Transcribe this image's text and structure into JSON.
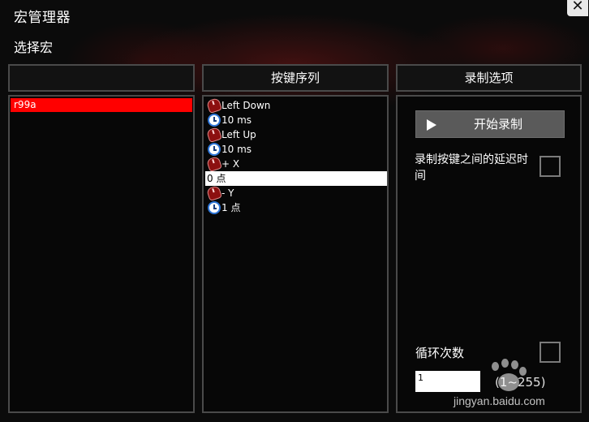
{
  "window": {
    "title": "宏管理器",
    "close_label": "✕"
  },
  "section_label": "选择宏",
  "macro_panel": {
    "header": "",
    "items": [
      {
        "label": "r99a",
        "selected": true
      }
    ]
  },
  "key_sequence": {
    "header": "按键序列",
    "items": [
      {
        "icon": "mouse-icon",
        "label": "Left Down"
      },
      {
        "icon": "clock-icon",
        "label": "10 ms"
      },
      {
        "icon": "mouse-icon",
        "label": "Left Up"
      },
      {
        "icon": "clock-icon",
        "label": "10 ms"
      },
      {
        "icon": "mouse-icon",
        "label": "+ X"
      },
      {
        "icon": "",
        "label": "0 点",
        "selected": true
      },
      {
        "icon": "mouse-icon",
        "label": "- Y"
      },
      {
        "icon": "clock-icon",
        "label": "1 点"
      }
    ]
  },
  "record_options": {
    "header": "录制选项",
    "start_button": "开始录制",
    "record_delay_label": "录制按键之间的延迟时间",
    "record_delay_checked": false,
    "loop_label": "循环次数",
    "loop_checked": false,
    "loop_count_value": "1",
    "loop_range": "(1~255)"
  },
  "watermark": {
    "text": "jingyan.baidu.com"
  },
  "colors": {
    "selected_red": "#ff0000",
    "panel_border": "#4a4a4a",
    "background": "#0b0b0b",
    "button_gray": "#5a5a5a"
  }
}
